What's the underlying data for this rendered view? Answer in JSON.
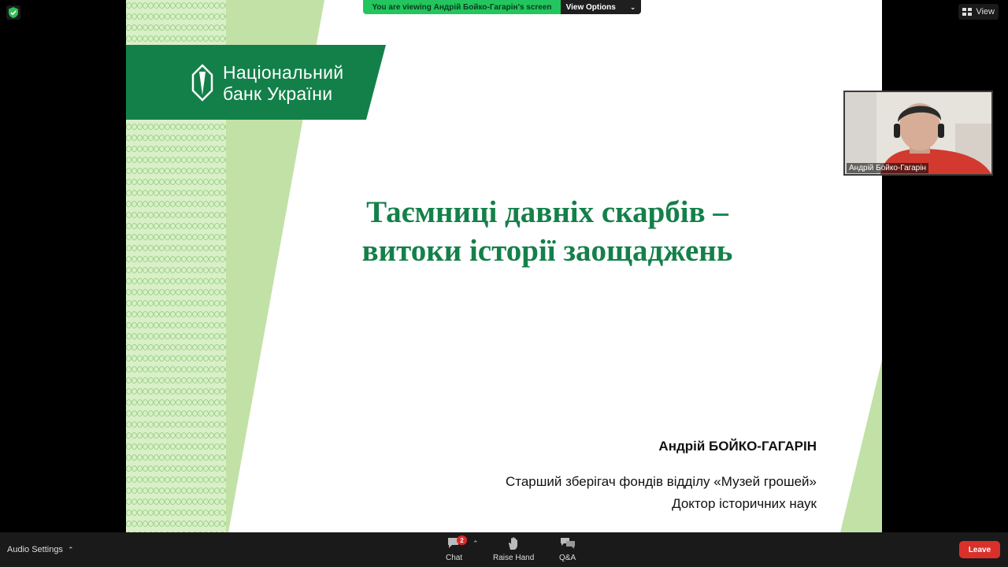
{
  "banner": {
    "viewing_text": "You are viewing Андрій Бойко-Гагарін's screen",
    "view_options_label": "View Options"
  },
  "top_right": {
    "view_label": "View"
  },
  "slide": {
    "logo_line1": "Національний",
    "logo_line2": "банк України",
    "title_line1": "Таємниці давніх скарбів –",
    "title_line2": "витоки історії заощаджень",
    "author": "Андрій БОЙКО-ГАГАРІН",
    "position_line1": "Старший зберігач фондів відділу «Музей грошей»",
    "position_line2": "Доктор історичних наук",
    "colors": {
      "brand_green": "#138049",
      "light_green": "#c2e1a6",
      "title_green": "#14804a"
    }
  },
  "video": {
    "participant_name": "Андрій Бойко-Гагарін"
  },
  "toolbar": {
    "audio_settings_label": "Audio Settings",
    "chat_label": "Chat",
    "chat_badge": "2",
    "raise_hand_label": "Raise Hand",
    "qa_label": "Q&A",
    "leave_label": "Leave"
  },
  "icons": [
    "shield-icon",
    "view-grid-icon",
    "chevron-down-icon",
    "chevron-up-icon",
    "chat-icon",
    "hand-icon",
    "qa-icon",
    "nbu-logo-icon"
  ]
}
